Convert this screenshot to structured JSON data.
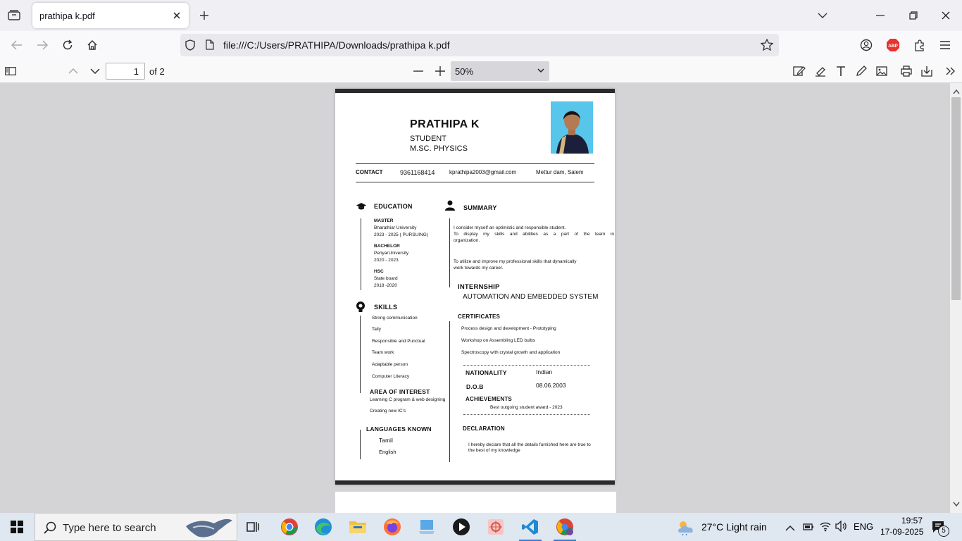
{
  "browser": {
    "tab_title": "prathipa k.pdf",
    "url": "file:///C:/Users/PRATHIPA/Downloads/prathipa k.pdf"
  },
  "pdf_toolbar": {
    "page_number": "1",
    "page_count": "of 2",
    "zoom": "50%"
  },
  "resume": {
    "name": "PRATHIPA K",
    "role": "STUDENT",
    "degree": "M.SC. PHYSICS",
    "contact_label": "CONTACT",
    "phone": "9361168414",
    "email": "kprathipa2003@gmail.com",
    "location": "Mettur dam, Salem",
    "education_heading": "EDUCATION",
    "education": [
      {
        "level": "MASTER",
        "institution": "Bharathiar University",
        "years": "2023 - 2025 ( PURSUING)"
      },
      {
        "level": "BACHELOR",
        "institution": "PeriyarUniversity",
        "years": "2020 - 2023"
      },
      {
        "level": "HSC",
        "institution": "State board",
        "years": "2018 -2020"
      }
    ],
    "skills_heading": "SKILLS",
    "skills": [
      "Strong communication",
      "Tally",
      "Responsible and Punctual",
      "Team work",
      "Adaptable person",
      "Computer Literacy"
    ],
    "interest_heading": "AREA OF INTEREST",
    "interests": [
      "Learning C program & web designing",
      "Creating new IC's"
    ],
    "languages_heading": "LANGUAGES KNOWN",
    "languages": [
      "Tamil",
      "English"
    ],
    "summary_heading": "SUMMARY",
    "summary_p1_l1": "I consider myself an optimistic and responsible student.",
    "summary_p1_l2": "To display my skills and abilities as a part of the team in",
    "summary_p1_l3": "organization.",
    "summary_p2_l1": "To utilize and improve my professional skills that dynamically",
    "summary_p2_l2": "work towards my  career.",
    "internship_heading": "INTERNSHIP",
    "internship": "AUTOMATION  AND EMBEDDED SYSTEM",
    "certificates_heading": "CERTIFICATES",
    "certificates": [
      "Process design and development - Prototyping",
      "Workshop on Assembling LED bulbs",
      "Spectroscopy with crystal growth and application"
    ],
    "nationality_label": "NATIONALITY",
    "nationality": "Indian",
    "dob_label": "D.O.B",
    "dob": "08.06.2003",
    "achievements_heading": "ACHIEVEMENTS",
    "achievement": "Best outgoing student award - 2023",
    "declaration_heading": "DECLARATION",
    "declaration_l1": "I hereby declare that all the details furnished here are true to",
    "declaration_l2": "the best of my knowledge"
  },
  "taskbar": {
    "search_placeholder": "Type here to search",
    "weather": "27°C  Light rain",
    "language": "ENG",
    "time": "19:57",
    "date": "17-09-2025",
    "notification_count": "5"
  }
}
